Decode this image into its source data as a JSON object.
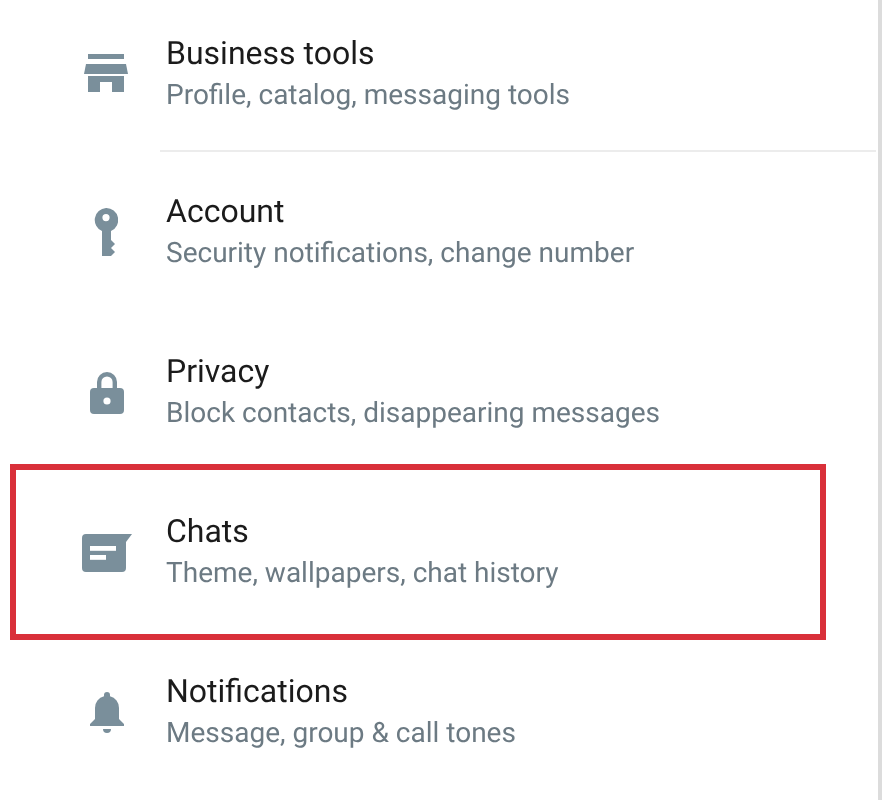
{
  "settings": [
    {
      "title": "Business tools",
      "subtitle": "Profile, catalog, messaging tools",
      "divider": true,
      "highlighted": false
    },
    {
      "title": "Account",
      "subtitle": "Security notifications, change number",
      "divider": false,
      "highlighted": false
    },
    {
      "title": "Privacy",
      "subtitle": "Block contacts, disappearing messages",
      "divider": false,
      "highlighted": false
    },
    {
      "title": "Chats",
      "subtitle": "Theme, wallpapers, chat history",
      "divider": false,
      "highlighted": true
    },
    {
      "title": "Notifications",
      "subtitle": "Message, group & call tones",
      "divider": false,
      "highlighted": false
    }
  ]
}
